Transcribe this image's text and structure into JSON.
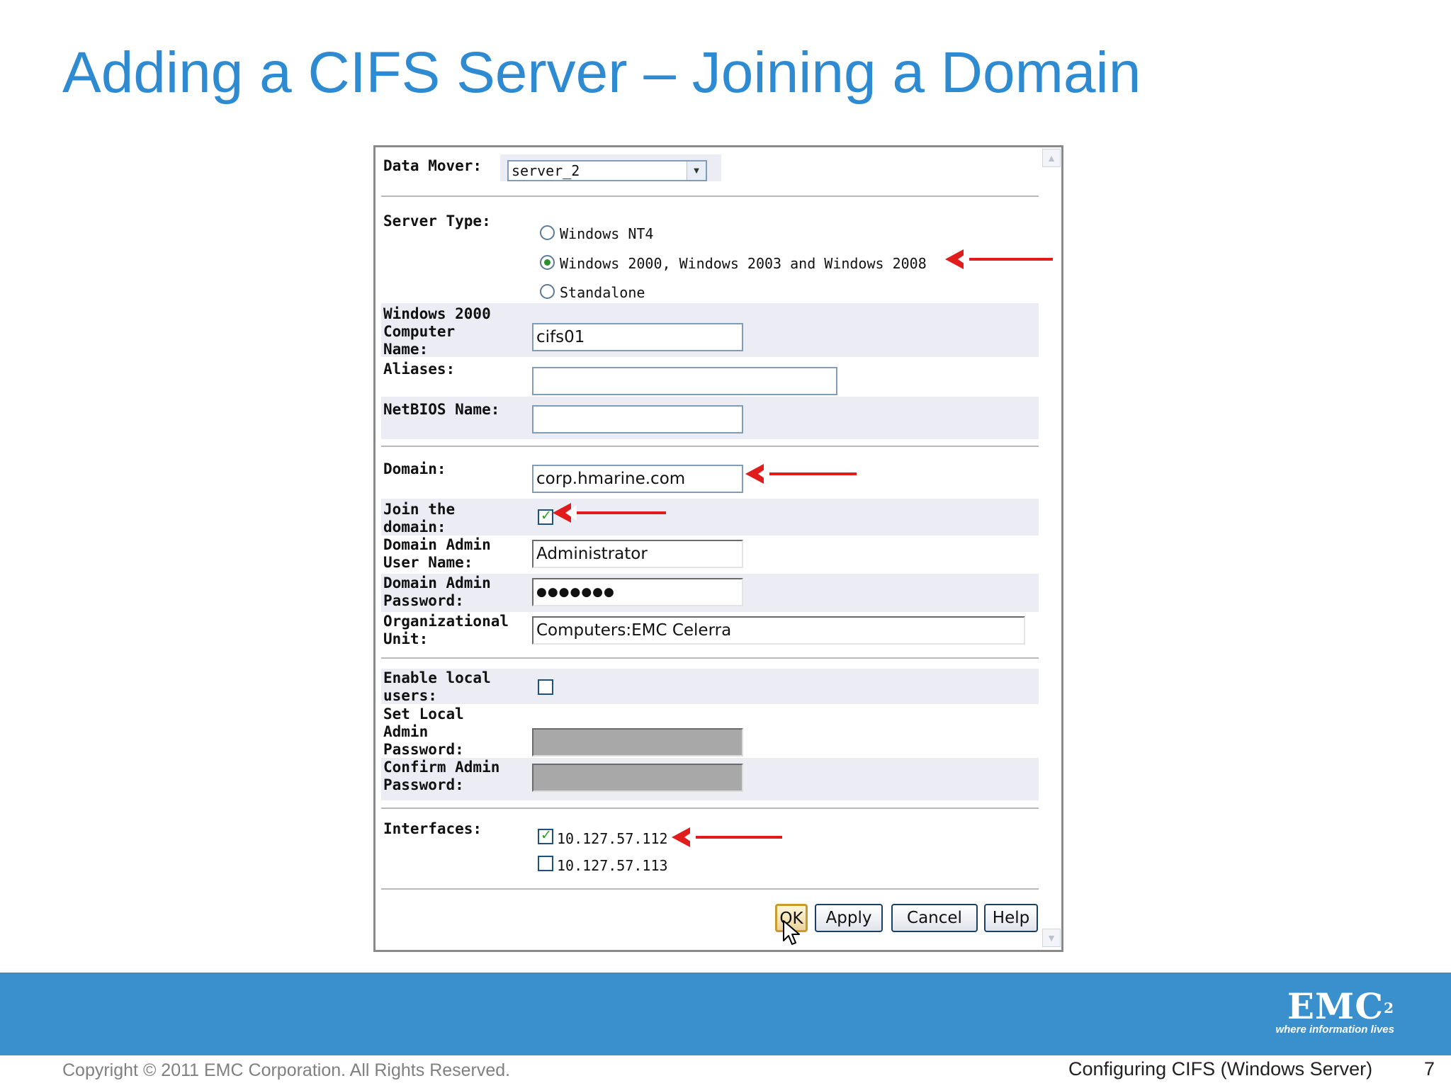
{
  "slide": {
    "title": "Adding a CIFS Server – Joining a Domain",
    "footer_copyright": "Copyright © 2011 EMC Corporation. All Rights Reserved.",
    "footer_topic": "Configuring CIFS (Windows Server)",
    "page_number": "7",
    "logo_text": "EMC",
    "logo_superscript": "2",
    "logo_tagline": "where information lives"
  },
  "form": {
    "data_mover": {
      "label": "Data Mover:",
      "selected": "server_2"
    },
    "server_type": {
      "label": "Server Type:",
      "options": [
        "Windows NT4",
        "Windows 2000, Windows 2003 and Windows 2008",
        "Standalone"
      ],
      "selected_index": 1
    },
    "computer_name": {
      "label": "Windows 2000\nComputer\nName:",
      "value": "cifs01"
    },
    "aliases": {
      "label": "Aliases:",
      "value": ""
    },
    "netbios_name": {
      "label": "NetBIOS Name:",
      "value": ""
    },
    "domain": {
      "label": "Domain:",
      "value": "corp.hmarine.com"
    },
    "join_domain": {
      "label": "Join the\ndomain:",
      "checked": true
    },
    "admin_user": {
      "label": "Domain Admin\nUser Name:",
      "value": "Administrator"
    },
    "admin_password": {
      "label": "Domain Admin\nPassword:",
      "value": "●●●●●●●"
    },
    "org_unit": {
      "label": "Organizational\nUnit:",
      "value": "Computers:EMC Celerra"
    },
    "enable_local_users": {
      "label": "Enable local\nusers:",
      "checked": false
    },
    "local_admin_password": {
      "label": "Set Local\nAdmin\nPassword:"
    },
    "confirm_admin_password": {
      "label": "Confirm Admin\nPassword:"
    },
    "interfaces": {
      "label": "Interfaces:",
      "items": [
        {
          "address": "10.127.57.112",
          "checked": true
        },
        {
          "address": "10.127.57.113",
          "checked": false
        }
      ]
    },
    "buttons": {
      "ok": "OK",
      "apply": "Apply",
      "cancel": "Cancel",
      "help": "Help"
    }
  },
  "colors": {
    "title": "#2e8bd1",
    "banner": "#3a90cd",
    "annotation_arrow": "#e01c1c"
  }
}
